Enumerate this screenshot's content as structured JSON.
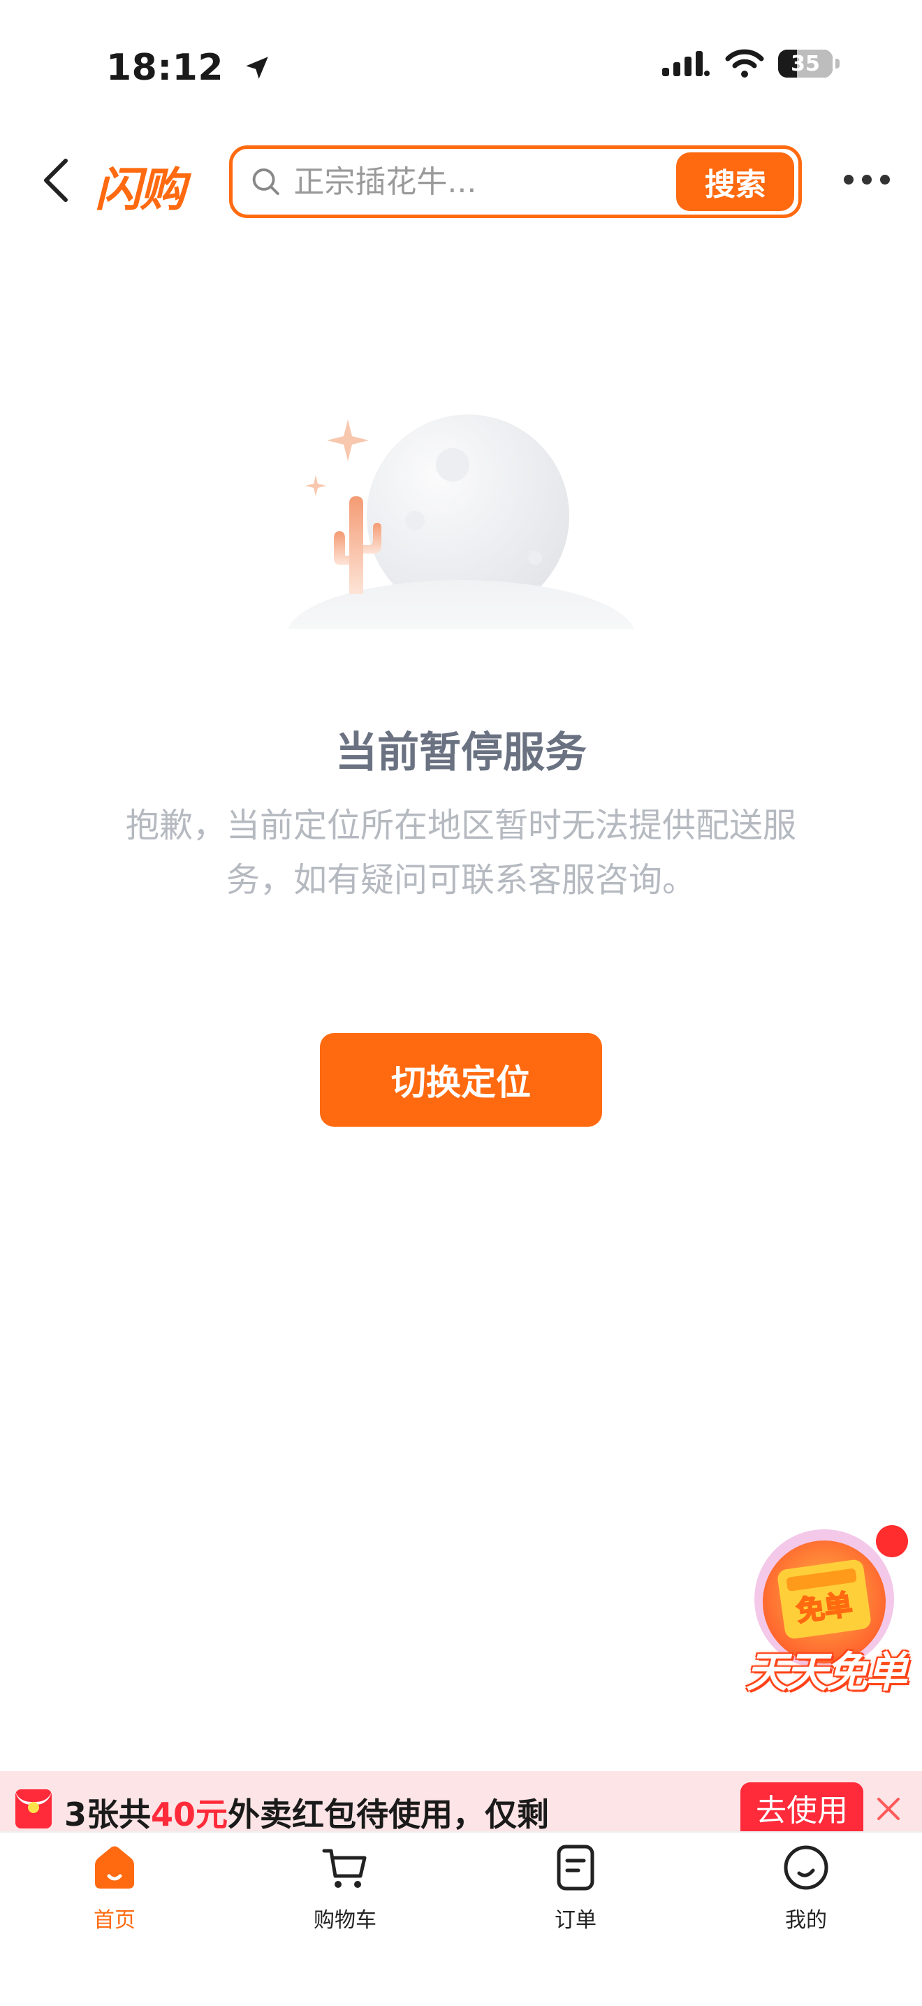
{
  "status_bar": {
    "time": "18:12",
    "battery": "35"
  },
  "header": {
    "brand": "闪购",
    "search_placeholder": "正宗插花牛...",
    "search_button": "搜索"
  },
  "empty_state": {
    "title": "当前暂停服务",
    "description": "抱歉，当前定位所在地区暂时无法提供配送服务，如有疑问可联系客服咨询。",
    "button": "切换定位"
  },
  "promo": {
    "badge": "免单",
    "slogan": "天天免单"
  },
  "banner": {
    "prefix": "3张共",
    "amount": "40元",
    "suffix": "外卖红包待使用，仅剩",
    "button": "去使用"
  },
  "tabs": [
    {
      "label": "首页",
      "icon": "home-icon",
      "active": true
    },
    {
      "label": "购物车",
      "icon": "cart-icon",
      "active": false
    },
    {
      "label": "订单",
      "icon": "order-icon",
      "active": false
    },
    {
      "label": "我的",
      "icon": "profile-icon",
      "active": false
    }
  ],
  "colors": {
    "accent": "#ff6a10",
    "red": "#ff2a3a",
    "banner_bg": "#fde4e6"
  }
}
